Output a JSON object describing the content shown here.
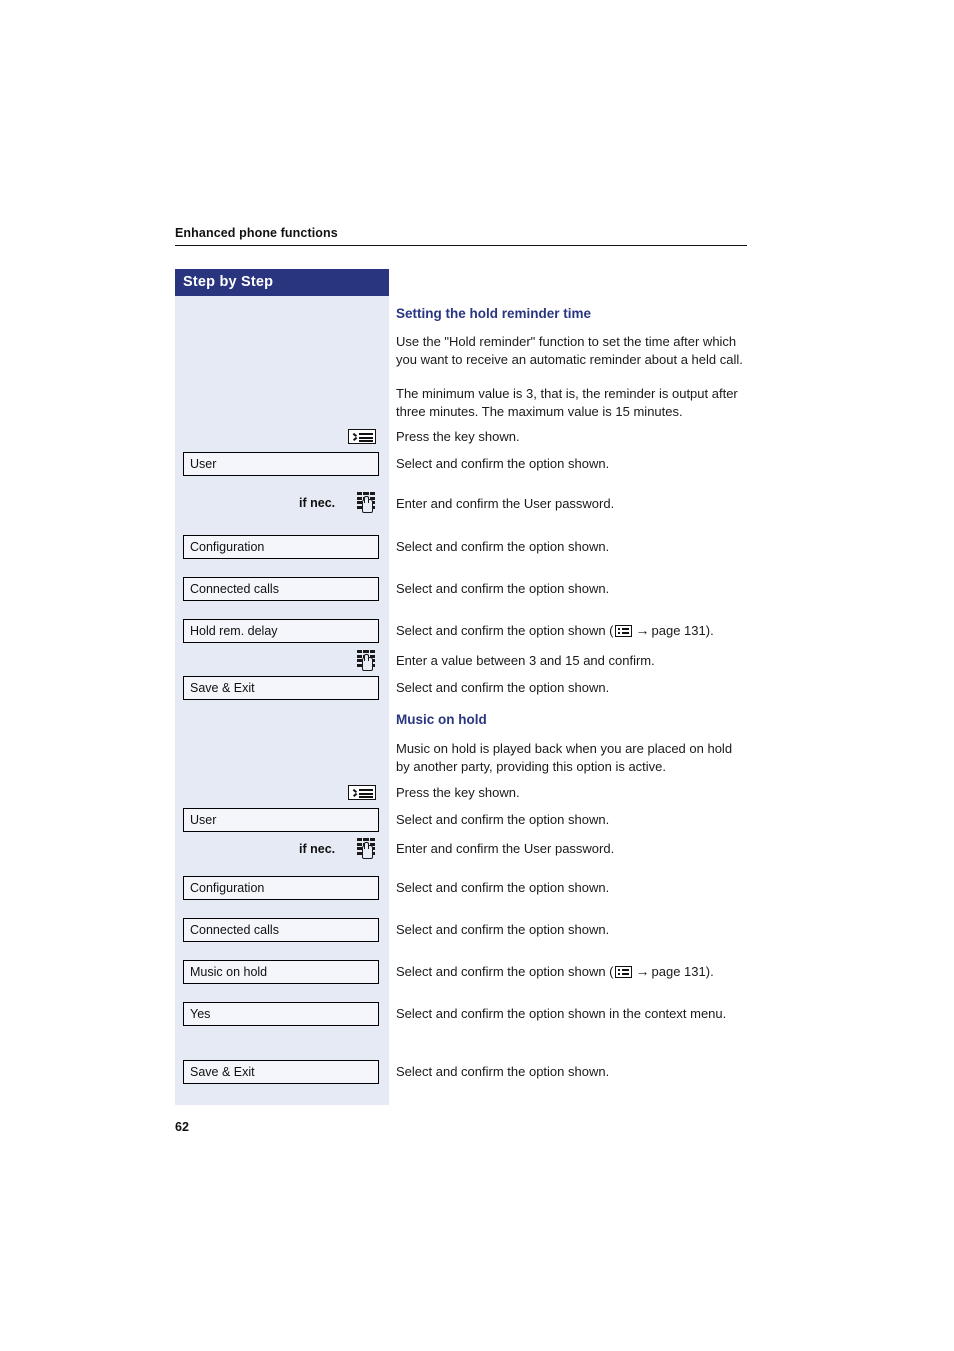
{
  "document": {
    "running_header": "Enhanced phone functions",
    "page_number": "62"
  },
  "sidebar": {
    "heading": "Step by Step"
  },
  "sections": [
    {
      "heading": "Setting the hold reminder time",
      "intro_paragraphs": [
        "Use the \"Hold reminder\" function to set the time after which you want to receive an automatic reminder about a held call.",
        "The minimum value is 3, that is, the reminder is output after three minutes. The maximum value is 15 minutes."
      ]
    },
    {
      "heading": "Music on hold",
      "intro_paragraphs": [
        "Music on hold is played back when you are placed on hold by another party, providing this option is active."
      ]
    }
  ],
  "steps_hold_reminder": [
    {
      "left_icon": "menu-key-icon",
      "left_label": "",
      "right_text": "Press the key shown."
    },
    {
      "left_box": "User",
      "right_text": "Select and confirm the option shown."
    },
    {
      "left_icon": "keypad-icon",
      "left_label": "if nec.",
      "right_text": "Enter and confirm the User password."
    },
    {
      "left_box": "Configuration",
      "right_text": "Select and confirm the option shown."
    },
    {
      "left_box": "Connected calls",
      "right_text": "Select and confirm the option shown."
    },
    {
      "left_box": "Hold rem. delay",
      "right_text_pre": "Select and confirm the option shown (",
      "right_ref_page": "page 131",
      "right_text_post": ")."
    },
    {
      "left_icon": "keypad-icon",
      "left_label": "",
      "right_text": "Enter a value between 3 and 15 and confirm."
    },
    {
      "left_box": "Save & Exit",
      "right_text": "Select and confirm the option shown."
    }
  ],
  "steps_music_on_hold": [
    {
      "left_icon": "menu-key-icon",
      "left_label": "",
      "right_text": "Press the key shown."
    },
    {
      "left_box": "User",
      "right_text": "Select and confirm the option shown."
    },
    {
      "left_icon": "keypad-icon",
      "left_label": "if nec.",
      "right_text": "Enter and confirm the User password."
    },
    {
      "left_box": "Configuration",
      "right_text": "Select and confirm the option shown."
    },
    {
      "left_box": "Connected calls",
      "right_text": "Select and confirm the option shown."
    },
    {
      "left_box": "Music on hold",
      "right_text_pre": "Select and confirm the option shown (",
      "right_ref_page": "page 131",
      "right_text_post": ")."
    },
    {
      "left_box": "Yes",
      "right_text": "Select and confirm the option shown in the context menu."
    },
    {
      "left_box": "Save & Exit",
      "right_text": "Select and confirm the option shown."
    }
  ],
  "colors": {
    "panel_background": "#e5eaf5",
    "panel_header": "#2a3580",
    "section_heading": "#2a3580",
    "body_text": "#1a1a1a"
  }
}
